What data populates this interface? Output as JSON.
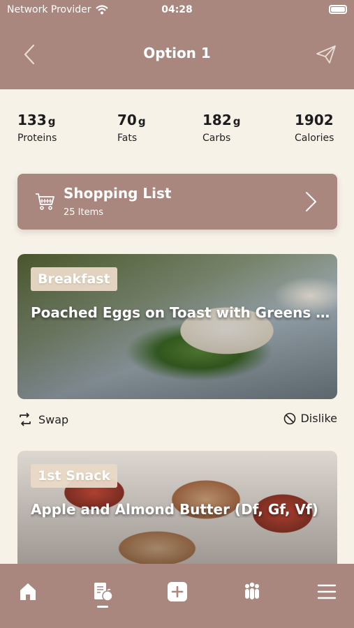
{
  "status_bar": {
    "carrier": "Network Provider",
    "time": "04:28"
  },
  "header": {
    "title": "Option 1"
  },
  "macros": [
    {
      "value": "133",
      "unit": "g",
      "label": "Proteins"
    },
    {
      "value": "70",
      "unit": "g",
      "label": "Fats"
    },
    {
      "value": "182",
      "unit": "g",
      "label": "Carbs"
    },
    {
      "value": "1902",
      "unit": "",
      "label": "Calories"
    }
  ],
  "shopping_list": {
    "title": "Shopping List",
    "count": "25 Items"
  },
  "meals": [
    {
      "category": "Breakfast",
      "title": "Poached Eggs on Toast with Greens (Df, Gf, Vf)"
    },
    {
      "category": "1st Snack",
      "title": "Apple and Almond Butter (Df, Gf, Vf)"
    }
  ],
  "actions": {
    "swap": "Swap",
    "dislike": "Dislike"
  },
  "colors": {
    "brand": "#a9877e",
    "background": "#f7f2e8",
    "badge": "#e9d9c6"
  },
  "tabbar": [
    "home-icon",
    "meal-plan-icon",
    "add-icon",
    "community-icon",
    "menu-icon"
  ]
}
